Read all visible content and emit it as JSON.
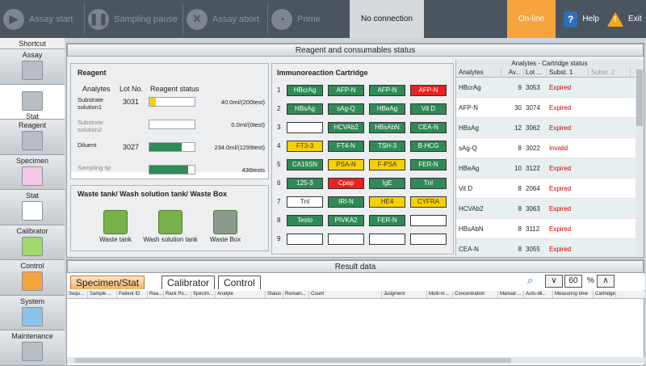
{
  "toolbar": {
    "assay_start": "Assay start",
    "sampling_pause": "Sampling pause",
    "assay_abort": "Assay abort",
    "prime": "Prime",
    "connection": "No connection",
    "online": "On-line",
    "help": "Help",
    "exit": "Exit"
  },
  "sidebar": {
    "title": "Shortcut",
    "items": [
      "Assay",
      "Stat",
      "Reagent",
      "Specimen",
      "Stat",
      "Calibrator",
      "Control",
      "System",
      "Maintenance"
    ]
  },
  "reagent_panel": {
    "header": "Reagent and consumables status",
    "title": "Reagent",
    "cols": [
      "Analytes",
      "Lot No.",
      "Reagent status"
    ],
    "rows": [
      {
        "name": "Substrate solution1",
        "lot": "3031",
        "value": "40.0ml/(200test)",
        "fill": 0.15,
        "color": "#f7d000"
      },
      {
        "name": "Substrate solution2",
        "lot": "",
        "value": "0.0ml/(0test)",
        "fill": 0,
        "color": "#2f8a55"
      },
      {
        "name": "Diluent",
        "lot": "3027",
        "value": "234.0ml/(1299test)",
        "fill": 0.72,
        "color": "#2f8a55"
      },
      {
        "name": "Sampling tip",
        "lot": "",
        "value": "436tests",
        "fill": 0.85,
        "color": "#2f8a55"
      }
    ]
  },
  "waste": {
    "title": "Waste tank/ Wash solution tank/ Waste Box",
    "items": [
      "Waste tank",
      "Wash solution tank",
      "Waste Box"
    ]
  },
  "cartridge": {
    "title": "Immunoreaction Cartridge",
    "rows": [
      [
        [
          "HBcrAg",
          "g"
        ],
        [
          "AFP-N",
          "g"
        ],
        [
          "AFP-N",
          "g"
        ],
        [
          "AFP-N",
          "r"
        ]
      ],
      [
        [
          "HBsAg",
          "g"
        ],
        [
          "sAg-Q",
          "g"
        ],
        [
          "HBeAg",
          "g"
        ],
        [
          "Vit D",
          "g"
        ]
      ],
      [
        [
          "",
          "w"
        ],
        [
          "HCVAb2",
          "g"
        ],
        [
          "HBsAbN",
          "g"
        ],
        [
          "CEA-N",
          "g"
        ]
      ],
      [
        [
          "FT3-3",
          "y"
        ],
        [
          "FT4-N",
          "g"
        ],
        [
          "TSH-3",
          "g"
        ],
        [
          "B-HCG",
          "g"
        ]
      ],
      [
        [
          "CA19SN",
          "g"
        ],
        [
          "PSA-N",
          "y"
        ],
        [
          "F-PSA",
          "y"
        ],
        [
          "FER-N",
          "g"
        ]
      ],
      [
        [
          "125-3",
          "g"
        ],
        [
          "Cpep",
          "r"
        ],
        [
          "IgE",
          "g"
        ],
        [
          "TnI",
          "g"
        ]
      ],
      [
        [
          "TnI",
          "w"
        ],
        [
          "IRI-N",
          "g"
        ],
        [
          "HE4",
          "y"
        ],
        [
          "CYFRA",
          "y"
        ]
      ],
      [
        [
          "Testo",
          "g"
        ],
        [
          "PIVKA2",
          "g"
        ],
        [
          "FER-N",
          "g"
        ],
        [
          "",
          "w"
        ]
      ],
      [
        [
          "",
          "w"
        ],
        [
          "",
          "w"
        ],
        [
          "",
          "w"
        ],
        [
          "",
          "w"
        ]
      ]
    ]
  },
  "status_table": {
    "title": "Analytes - Cartridge status",
    "cols": [
      "Analytes",
      "Av...",
      "Lot ...",
      "Subst. 1",
      "Subst. 2"
    ],
    "rows": [
      [
        "HBcrAg",
        "9",
        "3053",
        "Expired",
        ""
      ],
      [
        "AFP-N",
        "30",
        "3074",
        "Expired",
        ""
      ],
      [
        "HBsAg",
        "12",
        "3062",
        "Expired",
        ""
      ],
      [
        "sAg-Q",
        "8",
        "3022",
        "Invalid",
        ""
      ],
      [
        "HBeAg",
        "10",
        "3122",
        "Expired",
        ""
      ],
      [
        "Vit D",
        "8",
        "2064",
        "Expired",
        ""
      ],
      [
        "HCVAb2",
        "8",
        "3063",
        "Expired",
        ""
      ],
      [
        "HBsAbN",
        "8",
        "3112",
        "Expired",
        ""
      ],
      [
        "CEA-N",
        "8",
        "3055",
        "Expired",
        ""
      ]
    ]
  },
  "result": {
    "header": "Result data",
    "tabs": [
      "Specimen/Stat",
      "Calibrator",
      "Control"
    ],
    "zoom": "60",
    "pct": "%",
    "down": "∨",
    "up": "∧",
    "cols": [
      "Sequ...",
      "Sample ...",
      "Patient ID",
      "Rea...",
      "Rack Po...",
      "Specim...",
      "Analyte",
      "Status",
      "Remain...",
      "Count",
      "Judgment",
      "Multi-m...",
      "Concentration",
      "Manual ...",
      "Auto-dil...",
      "Measuring time",
      "Cartridge"
    ]
  }
}
